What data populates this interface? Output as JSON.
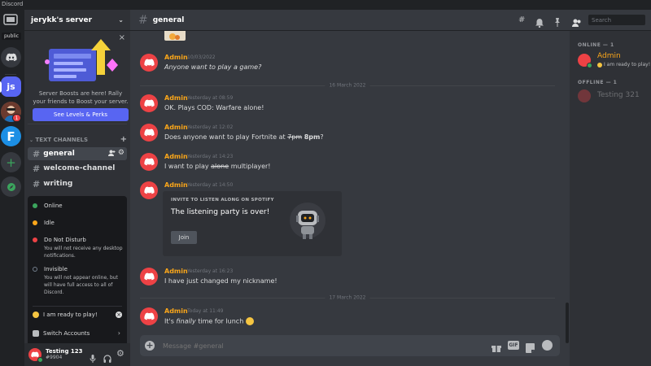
{
  "app": {
    "title": "Discord"
  },
  "guilds": {
    "home_label": "public",
    "js_label": "js",
    "f_label": "F",
    "badge": "1"
  },
  "server": {
    "name": "jerykk's server"
  },
  "boost": {
    "text": "Server Boosts are here! Rally your friends to Boost your server.",
    "button": "See Levels & Perks"
  },
  "channels": {
    "category": "TEXT CHANNELS",
    "items": [
      {
        "label": "general"
      },
      {
        "label": "welcome-channel"
      },
      {
        "label": "writing"
      }
    ]
  },
  "status_menu": {
    "online": "Online",
    "idle": "Idle",
    "dnd": "Do Not Disturb",
    "dnd_sub": "You will not receive any desktop notifications.",
    "invisible": "Invisible",
    "invisible_sub": "You will not appear online, but will have full access to all of Discord.",
    "custom": "I am ready to play!",
    "switch": "Switch Accounts"
  },
  "user": {
    "name": "Testing 123",
    "tag": "#9904"
  },
  "header": {
    "channel": "general",
    "search_placeholder": "Search"
  },
  "messages": [
    {
      "author": "Admin",
      "time": "10/03/2022",
      "text": "Anyone want to play a game?"
    },
    {
      "author": "Admin",
      "time": "Yesterday at 08:59",
      "text": "OK. Plays COD: Warfare alone!"
    },
    {
      "author": "Admin",
      "time": "Yesterday at 12:02",
      "text_pre": "Does anyone want to play Fortnite at ",
      "strike": "7pm",
      "bold": "8pm",
      "text_post": "?"
    },
    {
      "author": "Admin",
      "time": "Yesterday at 14:23",
      "text_pre": "I want to play ",
      "strike": "alone",
      "text_post": " multiplayer!"
    },
    {
      "author": "Admin",
      "time": "Yesterday at 14:50"
    },
    {
      "author": "Admin",
      "time": "Yesterday at 16:23",
      "text": "I have just changed my nickname!"
    },
    {
      "author": "Admin",
      "time": "Today at 11:49",
      "text_pre": "It's ",
      "italic": "finally",
      "text_post": " time for lunch"
    }
  ],
  "dividers": [
    "16 March 2022",
    "17 March 2022"
  ],
  "spotify": {
    "label": "INVITE TO LISTEN ALONG ON SPOTIFY",
    "title": "The listening party is over!",
    "button": "Join"
  },
  "composer": {
    "placeholder": "Message #general"
  },
  "members": {
    "online_header": "ONLINE — 1",
    "offline_header": "OFFLINE — 1",
    "online": [
      {
        "name": "Admin",
        "status": "I am ready to play!"
      }
    ],
    "offline": [
      {
        "name": "Testing 321"
      }
    ]
  },
  "colors": {
    "accent": "#5865f2",
    "admin": "#faa61a",
    "avatar": "#ed4245",
    "online": "#3ba55d"
  }
}
